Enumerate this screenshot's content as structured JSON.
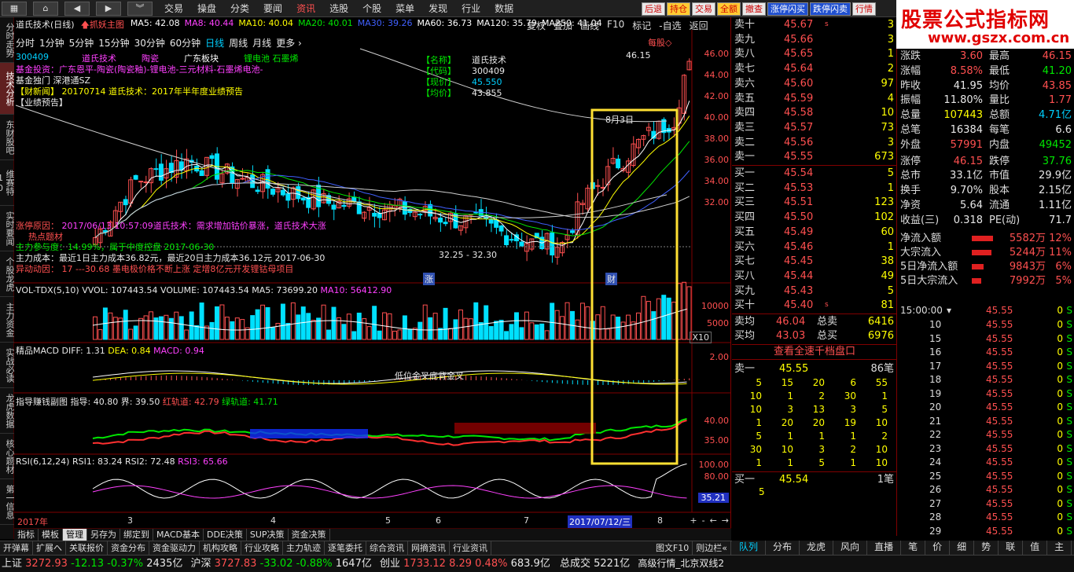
{
  "menu": {
    "items": [
      "交易",
      "操盘",
      "分类",
      "要闻",
      "资讯",
      "选股",
      "个股",
      "菜单",
      "发现",
      "行业",
      "数据"
    ],
    "active": "资讯",
    "quick": [
      "后退",
      "持仓",
      "交易",
      "全额",
      "撤查",
      "涨停闪买",
      "跌停闪卖",
      "行情"
    ],
    "chart_tools": [
      "复权",
      "叠加",
      "画线",
      "F10",
      "标记",
      "-自选",
      "返回"
    ]
  },
  "logo": {
    "line1": "股票公式指标网",
    "line2": "www.gszx.com.cn"
  },
  "left_tabs": [
    "分时走势",
    "技术分析",
    "东财股吧",
    "维赛特10",
    "实时要闻",
    "个股龙虎",
    "主力资金",
    "实战必读",
    "龙虎数据",
    "核心题材",
    "第一信息"
  ],
  "periods": [
    "分时",
    "1分钟",
    "5分钟",
    "15分钟",
    "30分钟",
    "60分钟",
    "日线",
    "周线",
    "月线",
    "更多 ›"
  ],
  "active_period": "日线",
  "header": {
    "stock": "道氏技术(日线)",
    "tag": "抓妖主图",
    "ma": [
      {
        "label": "MA5: 42.08",
        "color": "#ffffff"
      },
      {
        "label": "MA8: 40.44",
        "color": "#ff40ff"
      },
      {
        "label": "MA10: 40.04",
        "color": "#ffff00"
      },
      {
        "label": "MA20: 40.01",
        "color": "#00e600"
      },
      {
        "label": "MA30: 39.26",
        "color": "#4060ff"
      },
      {
        "label": "MA60: 36.73",
        "color": "#ffffff"
      },
      {
        "label": "MA120: 35.79",
        "color": "#ffffff"
      },
      {
        "label": "MA250: 41.04",
        "color": "#ffffff"
      }
    ],
    "right_tag": "每股◇"
  },
  "info": {
    "code": "300409",
    "concepts": [
      "道氏技术",
      "陶瓷",
      "广东板块",
      "锂电池 石墨烯"
    ],
    "line2": "基金投资：广东恩平-陶瓷(陶瓷釉)-锂电池-三元材料-石墨烯电池-",
    "line3": "基金独门 深港通SZ",
    "news_tag": "【财新闻】",
    "news": "20170714  道氏技术：2017年半年度业绩预告",
    "line5": "【业绩预告】",
    "fields": [
      {
        "k": "【名称】",
        "v": "道氏技术"
      },
      {
        "k": "【代码】",
        "v": "300409"
      },
      {
        "k": "【现价】",
        "v": "45.550"
      },
      {
        "k": "【均价】",
        "v": "43.855"
      }
    ],
    "reason_label": "涨停原因：",
    "reason": "2017/06/13 10:57:09道氏技术：需求增加钴价暴涨，道氏技术大涨",
    "hot": "热点题材",
    "inst": "主力参与度：14.99%，属于中度控盘  2017-06-30",
    "cost": "主力成本：最近1日主力成本36.82元，最近20日主力成本36.12元  2017-06-30",
    "move": "异动动因：   17 ---30.68  墨电极价格不断上涨 定增8亿元开发锂钴母项目",
    "ann_high": "46.15",
    "ann_date": "8月3日",
    "ann_range": "32.25 - 32.30",
    "tag_zt": "涨",
    "tag_cai": "财"
  },
  "price_axis": [
    "46.00",
    "44.00",
    "42.00",
    "40.00",
    "38.00",
    "36.00",
    "34.00",
    "32.00"
  ],
  "volume": {
    "title": "VOL-TDX(5,10)",
    "vvol": "VVOL: 107443.54",
    "volume": "VOLUME: 107443.54",
    "ma5": "MA5: 73699.20",
    "ma10": "MA10: 56412.90",
    "axis": [
      "10000",
      "5000"
    ],
    "unit": "X10"
  },
  "macd": {
    "title": "精品MACD",
    "diff": "DIFF: 1.31",
    "dea": "DEA: 0.84",
    "macd": "MACD: 0.94",
    "axis": "2.00",
    "note": "低位金叉底背金叉"
  },
  "money": {
    "title": "指导赚钱副图",
    "guide": "指导: 40.80",
    "line": "界: 39.50",
    "red": "红轨道: 42.79",
    "green": "绿轨道: 41.71",
    "axis": [
      "40.00",
      "35.00"
    ]
  },
  "rsi": {
    "title": "RSI(6,12,24)",
    "r1": "RSI1: 83.24",
    "r2": "RSI2: 72.48",
    "r3": "RSI3: 65.66",
    "axis": [
      "100.00",
      "80.00"
    ],
    "cur": "35.21"
  },
  "xaxis": {
    "year": "2017年",
    "months": [
      "3",
      "4",
      "5",
      "6",
      "7",
      "8"
    ],
    "cursor": "2017/07/12/三"
  },
  "bottom_tabs": [
    "指标",
    "模板",
    "管理",
    "另存为",
    "绑定到",
    "MACD基本",
    "DDE决策",
    "SUP决策",
    "资金决策"
  ],
  "bottom_tabs_active": "管理",
  "func_tabs": [
    "开弹幕",
    "扩展へ",
    "关联报价",
    "资金分布",
    "资金驱动力",
    "机构攻略",
    "行业攻略",
    "主力轨迹",
    "逐笔委托",
    "综合资讯",
    "网摘资讯",
    "行业资讯"
  ],
  "func_right": [
    "图文F10",
    "则边栏«"
  ],
  "orderbook": {
    "sells": [
      {
        "l": "卖十",
        "p": "45.67",
        "v": "3",
        "s": "s"
      },
      {
        "l": "卖九",
        "p": "45.66",
        "v": "3",
        "s": ""
      },
      {
        "l": "卖八",
        "p": "45.65",
        "v": "1",
        "s": ""
      },
      {
        "l": "卖七",
        "p": "45.64",
        "v": "2",
        "s": ""
      },
      {
        "l": "卖六",
        "p": "45.60",
        "v": "97",
        "s": ""
      },
      {
        "l": "卖五",
        "p": "45.59",
        "v": "4",
        "s": ""
      },
      {
        "l": "卖四",
        "p": "45.58",
        "v": "10",
        "s": ""
      },
      {
        "l": "卖三",
        "p": "45.57",
        "v": "73",
        "s": ""
      },
      {
        "l": "卖二",
        "p": "45.56",
        "v": "3",
        "s": ""
      },
      {
        "l": "卖一",
        "p": "45.55",
        "v": "673",
        "s": ""
      }
    ],
    "buys": [
      {
        "l": "买一",
        "p": "45.54",
        "v": "5",
        "s": ""
      },
      {
        "l": "买二",
        "p": "45.53",
        "v": "1",
        "s": ""
      },
      {
        "l": "买三",
        "p": "45.51",
        "v": "123",
        "s": ""
      },
      {
        "l": "买四",
        "p": "45.50",
        "v": "102",
        "s": ""
      },
      {
        "l": "买五",
        "p": "45.49",
        "v": "60",
        "s": ""
      },
      {
        "l": "买六",
        "p": "45.46",
        "v": "1",
        "s": ""
      },
      {
        "l": "买七",
        "p": "45.45",
        "v": "38",
        "s": ""
      },
      {
        "l": "买八",
        "p": "45.44",
        "v": "49",
        "s": ""
      },
      {
        "l": "买九",
        "p": "45.43",
        "v": "5",
        "s": ""
      },
      {
        "l": "买十",
        "p": "45.40",
        "v": "81",
        "s": "s"
      }
    ],
    "avg_sell_label": "卖均",
    "avg_sell": "46.04",
    "total_sell_label": "总卖",
    "total_sell": "6416",
    "avg_buy_label": "买均",
    "avg_buy": "43.03",
    "total_buy_label": "总买",
    "total_buy": "6976",
    "full_depth": "查看全速千档盘口",
    "sell1_label": "卖一",
    "sell1_price": "45.55",
    "sell1_count": "86笔",
    "grid": [
      [
        "5",
        "15",
        "20",
        "6",
        "55"
      ],
      [
        "10",
        "1",
        "2",
        "30",
        "1"
      ],
      [
        "10",
        "3",
        "13",
        "3",
        "5"
      ],
      [
        "1",
        "20",
        "20",
        "19",
        "10"
      ],
      [
        "5",
        "1",
        "1",
        "1",
        "2"
      ],
      [
        "30",
        "10",
        "3",
        "2",
        "10"
      ],
      [
        "1",
        "1",
        "5",
        "1",
        "10"
      ]
    ],
    "buy1_label": "买一",
    "buy1_price": "45.54",
    "buy1_count": "1笔",
    "buy1_detail": "5"
  },
  "quote": {
    "top": [
      {
        "l": "现价",
        "v": "45.55",
        "l2": "开盘",
        "v2": "41.95"
      }
    ],
    "rows": [
      {
        "l": "涨跌",
        "v": "3.60",
        "c": "red",
        "l2": "最高",
        "v2": "46.15",
        "c2": "red"
      },
      {
        "l": "涨幅",
        "v": "8.58%",
        "c": "red",
        "l2": "最低",
        "v2": "41.20",
        "c2": "grn"
      },
      {
        "l": "昨收",
        "v": "41.95",
        "c": "wht",
        "l2": "均价",
        "v2": "43.85",
        "c2": "red"
      },
      {
        "l": "振幅",
        "v": "11.80%",
        "c": "wht",
        "l2": "量比",
        "v2": "1.77",
        "c2": "red"
      },
      {
        "l": "总量",
        "v": "107443",
        "c": "yel",
        "l2": "总额",
        "v2": "4.71亿",
        "c2": "cy"
      },
      {
        "l": "总笔",
        "v": "16384",
        "c": "wht",
        "l2": "每笔",
        "v2": "6.6",
        "c2": "wht"
      },
      {
        "l": "外盘",
        "v": "57991",
        "c": "red",
        "l2": "内盘",
        "v2": "49452",
        "c2": "grn"
      },
      {
        "l": "涨停",
        "v": "46.15",
        "c": "red",
        "l2": "跌停",
        "v2": "37.76",
        "c2": "grn"
      },
      {
        "l": "总市",
        "v": "33.1亿",
        "c": "wht",
        "l2": "市值",
        "v2": "29.9亿",
        "c2": "wht"
      },
      {
        "l": "换手",
        "v": "9.70%",
        "c": "wht",
        "l2": "股本",
        "v2": "2.15亿",
        "c2": "wht"
      },
      {
        "l": "净资",
        "v": "5.64",
        "c": "wht",
        "l2": "流通",
        "v2": "1.11亿",
        "c2": "wht"
      },
      {
        "l": "收益(三)",
        "v": "0.318",
        "c": "wht",
        "l2": "PE(动)",
        "v2": "71.7",
        "c2": "wht"
      }
    ],
    "flows": [
      {
        "l": "净流入额",
        "v": "5582万",
        "p": "12%",
        "f": 0.45
      },
      {
        "l": "大宗流入",
        "v": "5244万",
        "p": "11%",
        "f": 0.42
      },
      {
        "l": "5日净流入额",
        "v": "9843万",
        "p": "6%",
        "f": 0.25
      },
      {
        "l": "5日大宗流入",
        "v": "7992万",
        "p": "5%",
        "f": 0.2
      }
    ]
  },
  "ticks": {
    "head": "15:00:00",
    "rows": [
      {
        "t": "10",
        "p": "45.55",
        "v": "0",
        "s": "S"
      },
      {
        "t": "15",
        "p": "45.55",
        "v": "0",
        "s": "S"
      },
      {
        "t": "16",
        "p": "45.55",
        "v": "0",
        "s": "S"
      },
      {
        "t": "17",
        "p": "45.55",
        "v": "0",
        "s": "S"
      },
      {
        "t": "18",
        "p": "45.55",
        "v": "0",
        "s": "S"
      },
      {
        "t": "19",
        "p": "45.55",
        "v": "0",
        "s": "S"
      },
      {
        "t": "20",
        "p": "45.55",
        "v": "0",
        "s": "S"
      },
      {
        "t": "21",
        "p": "45.55",
        "v": "0",
        "s": "S"
      },
      {
        "t": "22",
        "p": "45.55",
        "v": "0",
        "s": "S"
      },
      {
        "t": "23",
        "p": "45.55",
        "v": "0",
        "s": "S"
      },
      {
        "t": "24",
        "p": "45.55",
        "v": "0",
        "s": "S"
      },
      {
        "t": "25",
        "p": "45.55",
        "v": "0",
        "s": "S"
      },
      {
        "t": "26",
        "p": "45.55",
        "v": "0",
        "s": "S"
      },
      {
        "t": "27",
        "p": "45.55",
        "v": "0",
        "s": "S"
      },
      {
        "t": "28",
        "p": "45.55",
        "v": "0",
        "s": "S"
      },
      {
        "t": "29",
        "p": "45.55",
        "v": "0",
        "s": "S"
      },
      {
        "t": "30",
        "p": "45.55",
        "v": "0",
        "s": "S"
      }
    ]
  },
  "right_tabs": [
    "队列",
    "分布",
    "龙虎",
    "风向",
    "直播",
    "笔",
    "价",
    "细",
    "势",
    "联",
    "值",
    "主"
  ],
  "right_tabs_active": "队列",
  "status": {
    "sh_label": "上证",
    "sh": "3272.93",
    "sh_ch": "-12.13",
    "sh_pct": "-0.37%",
    "sh_amt": "2435亿",
    "hs_label": "沪深",
    "hs": "3727.83",
    "hs_ch": "-33.02",
    "hs_pct": "-0.88%",
    "hs_amt": "1647亿",
    "cy_label": "创业",
    "cy": "1733.12",
    "cy_ch": "8.29",
    "cy_pct": "0.48%",
    "cy_amt": "683.9亿",
    "total_label": "总成交",
    "total": "5221亿",
    "server": "高级行情_北京双线2"
  },
  "colors": {
    "up": "#ff5050",
    "down": "#00e0ff",
    "frame": "#800000",
    "highlight": "#ffe033"
  }
}
